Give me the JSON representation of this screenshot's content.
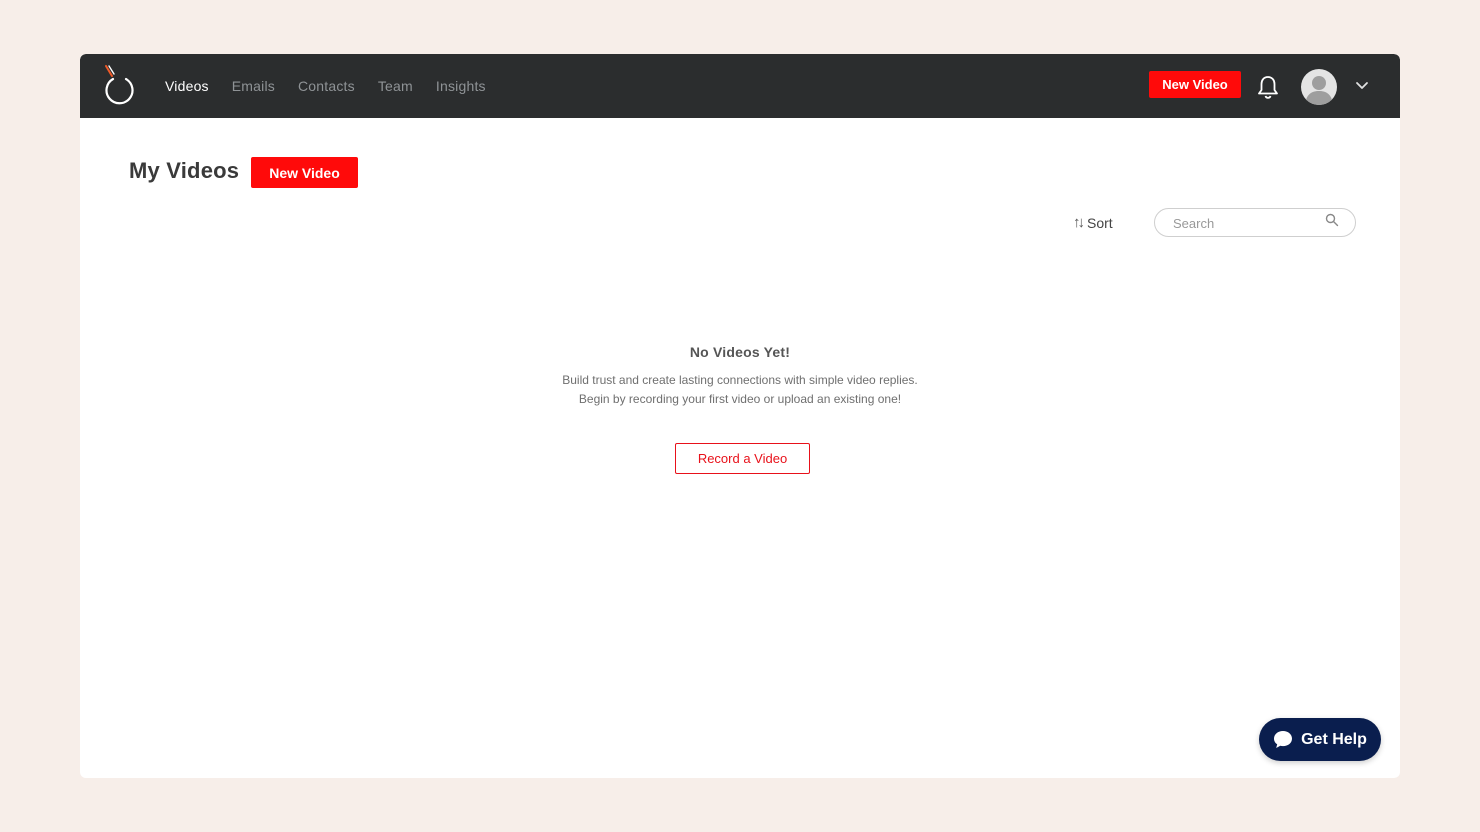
{
  "header": {
    "nav": [
      {
        "label": "Videos",
        "active": true
      },
      {
        "label": "Emails",
        "active": false
      },
      {
        "label": "Contacts",
        "active": false
      },
      {
        "label": "Team",
        "active": false
      },
      {
        "label": "Insights",
        "active": false
      }
    ],
    "new_video_label": "New Video",
    "icons": [
      "logo-icon",
      "bell-icon",
      "avatar",
      "chevron-down-icon"
    ]
  },
  "main": {
    "title": "My Videos",
    "new_video_label": "New Video",
    "sort_label": "Sort",
    "search_placeholder": "Search"
  },
  "empty_state": {
    "title": "No Videos Yet!",
    "line1": "Build trust and create lasting connections with simple video replies.",
    "line2": "Begin by recording your first video or upload an existing one!",
    "record_label": "Record a Video"
  },
  "help": {
    "label": "Get Help"
  },
  "colors": {
    "accent": "#ff0a0a",
    "topbar": "#2b2d2e",
    "help_bg": "#0a1e4e",
    "page_bg": "#f7eee9"
  }
}
